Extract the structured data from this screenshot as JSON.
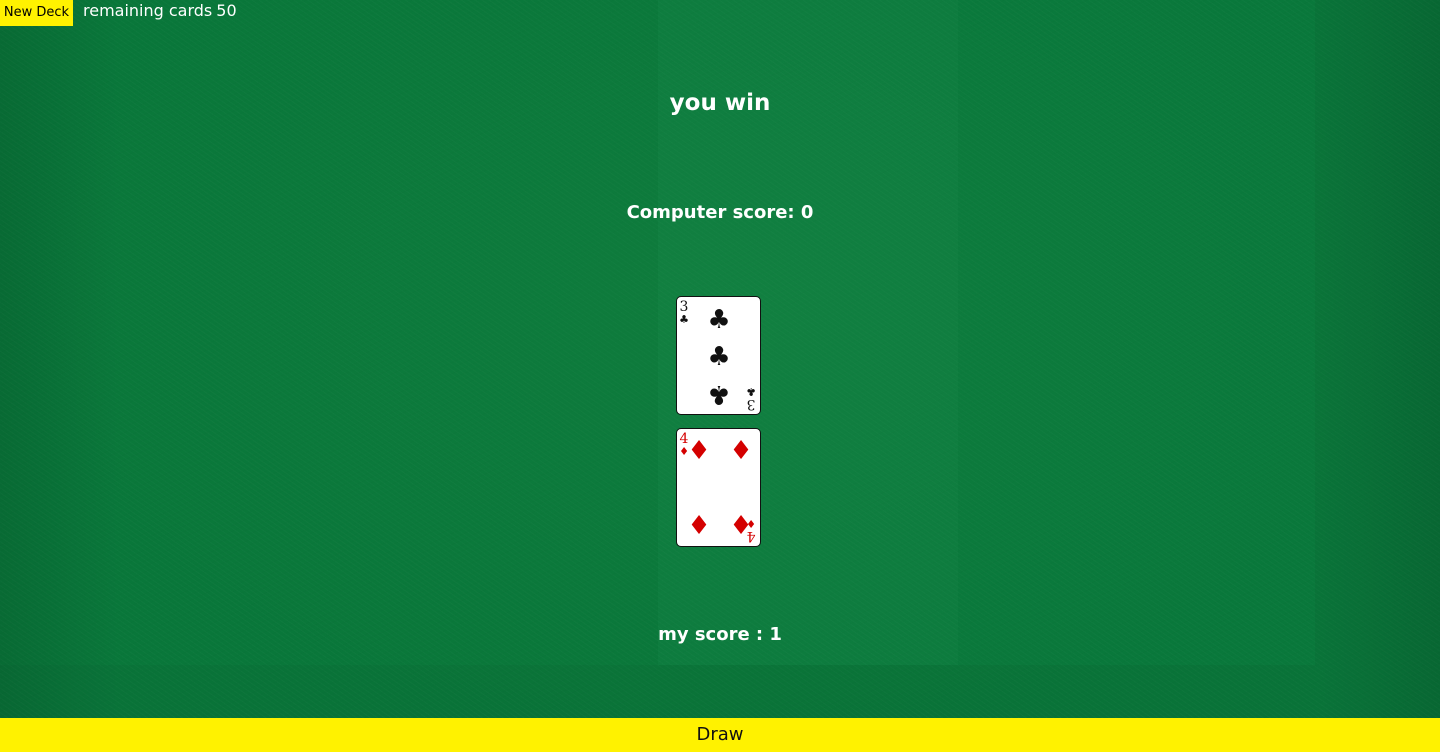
{
  "header": {
    "new_deck_label": "New Deck",
    "remaining_label": "remaining cards",
    "remaining_count": "50"
  },
  "game": {
    "status": "you win",
    "computer_score": "Computer score: 0",
    "my_score": "my score : 1"
  },
  "cards": [
    {
      "rank": "3",
      "suit": "♣",
      "suit_name": "clubs",
      "color": "#111111",
      "owner": "computer"
    },
    {
      "rank": "4",
      "suit": "♦",
      "suit_name": "diamonds",
      "color": "#d40000",
      "owner": "player"
    }
  ],
  "actions": {
    "draw_label": "Draw"
  },
  "colors": {
    "felt": "#0a7a3c",
    "button_yellow": "#fff200"
  }
}
